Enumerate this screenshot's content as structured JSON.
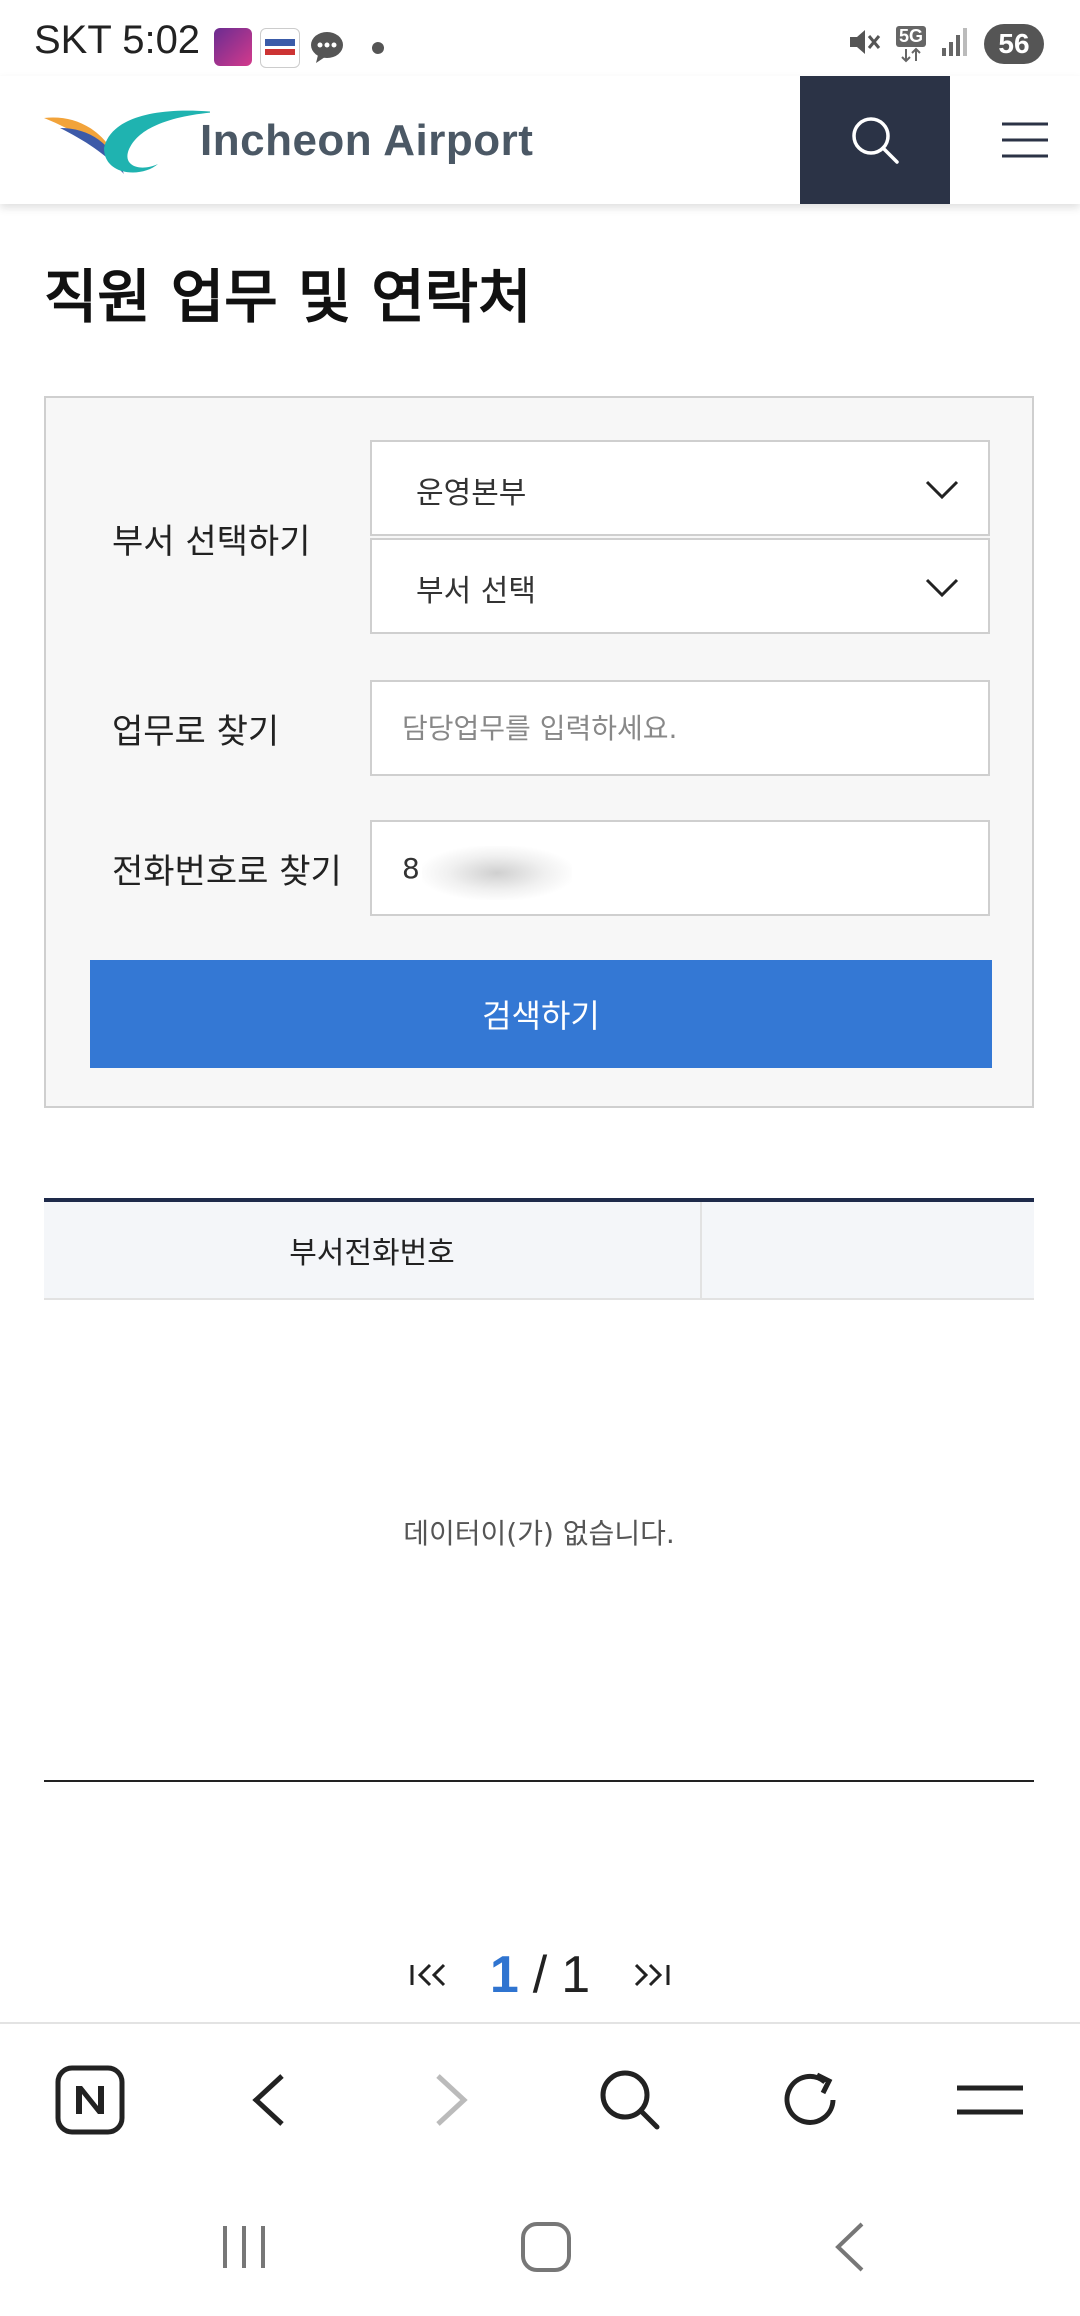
{
  "status_bar": {
    "carrier": "SKT",
    "time": "5:02",
    "network": "5G",
    "battery": "56"
  },
  "header": {
    "logo_text": "Incheon Airport",
    "icons": [
      "search-icon",
      "hamburger-menu-icon"
    ]
  },
  "page": {
    "title": "직원 업무 및 연락처"
  },
  "search_form": {
    "department_label": "부서 선택하기",
    "division_select": "운영본부",
    "department_select": "부서 선택",
    "task_label": "업무로 찾기",
    "task_placeholder": "담당업무를 입력하세요.",
    "phone_label": "전화번호로 찾기",
    "phone_value": "8",
    "submit_label": "검색하기"
  },
  "results_table": {
    "columns": [
      "부서전화번호",
      ""
    ],
    "empty_message": "데이터이(가) 없습니다."
  },
  "pagination": {
    "current": "1",
    "separator": "/",
    "total": "1"
  },
  "colors": {
    "primary_button": "#3478d4",
    "header_search_bg": "#2b3346",
    "table_top_border": "#1e2a4a",
    "page_current": "#2f74d0"
  }
}
